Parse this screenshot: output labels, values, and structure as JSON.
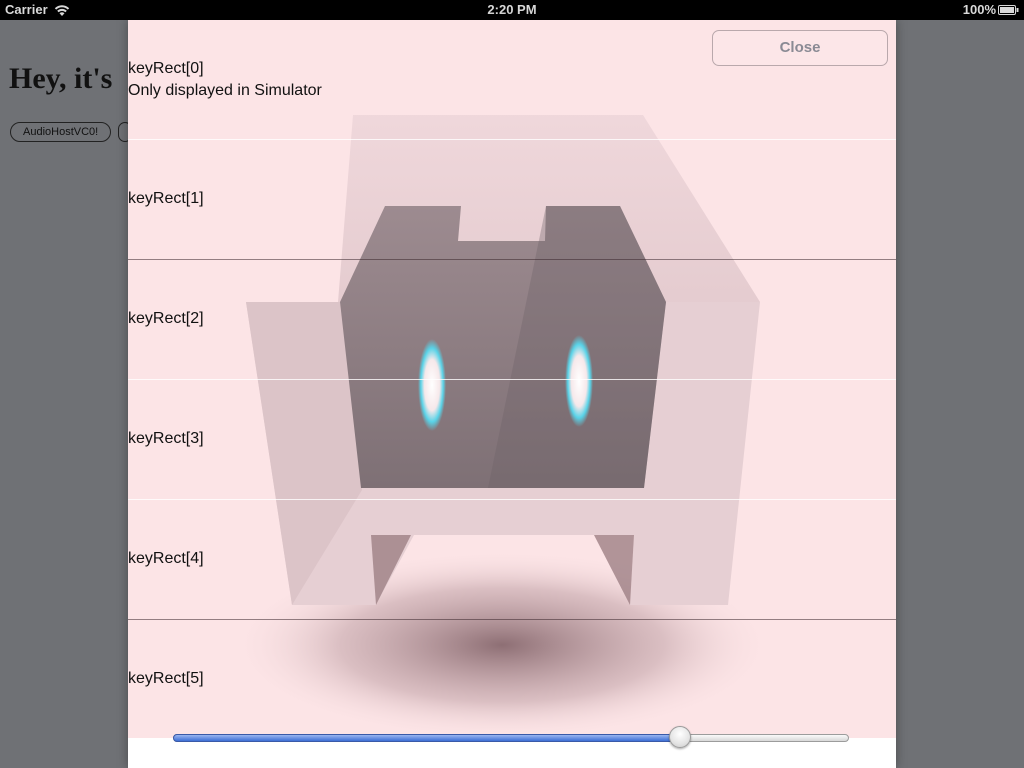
{
  "status_bar": {
    "carrier": "Carrier",
    "time": "2:20 PM",
    "battery": "100%",
    "wifi_icon": "wifi-icon",
    "battery_icon": "battery-icon"
  },
  "background_page": {
    "heading": "Hey, it's",
    "buttons": [
      "AudioHostVC0!",
      ""
    ]
  },
  "modal": {
    "close_label": "Close",
    "note": "Only displayed in Simulator",
    "key_rects": [
      "keyRect[0]",
      "keyRect[1]",
      "keyRect[2]",
      "keyRect[3]",
      "keyRect[4]",
      "keyRect[5]"
    ],
    "logo_icon": "cordova-robot-logo",
    "slider": {
      "value": 0.75
    }
  },
  "colors": {
    "modal_background": "#fce4e6",
    "dim_overlay": "#6f7175",
    "slider_fill": "#3d6fd6"
  }
}
